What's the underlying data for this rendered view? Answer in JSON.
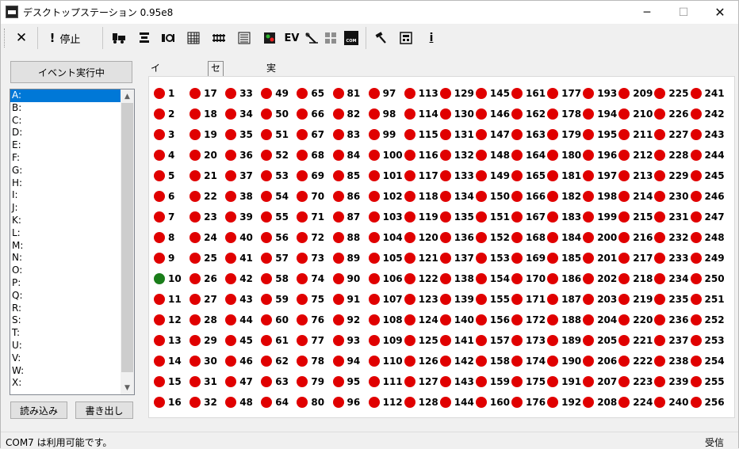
{
  "window": {
    "title": "デスクトップステーション 0.95e8",
    "min_glyph": "─",
    "max_glyph": "☐",
    "close_glyph": "✕"
  },
  "toolbar": {
    "close_glyph": "✕",
    "stop_glyph": "!",
    "stop_label": "停止",
    "ev_label": "EV",
    "com_label": "COM",
    "help_label": "i"
  },
  "left": {
    "run_button": "イベント実行中",
    "list_items": [
      "A:",
      "B:",
      "C:",
      "D:",
      "E:",
      "F:",
      "G:",
      "H:",
      "I:",
      "J:",
      "K:",
      "L:",
      "M:",
      "N:",
      "O:",
      "P:",
      "Q:",
      "R:",
      "S:",
      "T:",
      "U:",
      "V:",
      "W:",
      "X:"
    ],
    "selected_index": 0,
    "load_button": "読み込み",
    "save_button": "書き出し"
  },
  "tabs": [
    {
      "label": "イベント編集"
    },
    {
      "label": "センサ状態"
    },
    {
      "label": "実行状態"
    }
  ],
  "active_tab": 1,
  "sensors": {
    "count": 256,
    "rows_per_column": 16,
    "active": [
      10
    ],
    "on_color": "#1a7d1a",
    "off_color": "#e00000"
  },
  "status": {
    "left": "COM7 は利用可能です。",
    "right": "受信"
  }
}
